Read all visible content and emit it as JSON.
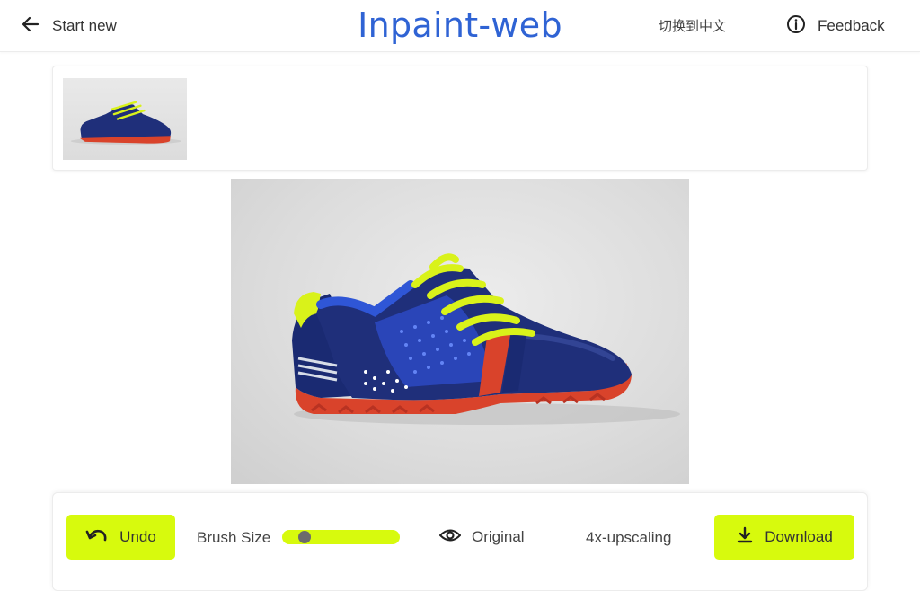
{
  "header": {
    "start_new_label": "Start new",
    "title": "Inpaint-web",
    "language_switch_label": "切换到中文",
    "feedback_label": "Feedback"
  },
  "toolbar": {
    "undo_label": "Undo",
    "brush_size_label": "Brush Size",
    "brush_size_value": 0.14,
    "original_label": "Original",
    "upscale_label": "4x-upscaling",
    "download_label": "Download"
  },
  "images": {
    "thumbnail_alt": "sneaker thumbnail",
    "main_alt": "blue sneaker with neon yellow laces and red sole"
  },
  "icons": {
    "start_new": "arrow-left-icon",
    "feedback": "info-circle-icon",
    "undo": "undo-arrow-icon",
    "original": "eye-icon",
    "download": "download-icon"
  },
  "colors": {
    "accent": "#d7fa0d",
    "title": "#2f63d4",
    "shoe_upper": "#1f2f7a",
    "shoe_laces": "#d9f21a",
    "shoe_sole": "#d9432b"
  }
}
